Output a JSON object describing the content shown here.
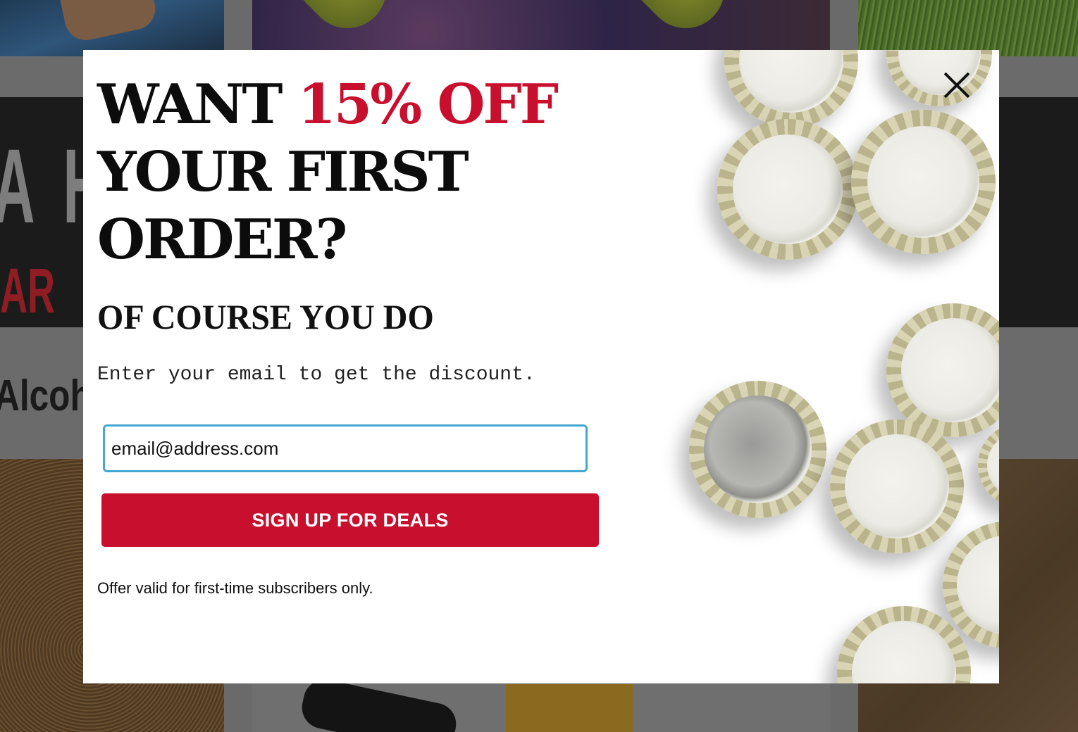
{
  "background": {
    "partial_heading": "Alcoh"
  },
  "popup": {
    "headline_part1": "WANT ",
    "headline_accent": "15% OFF",
    "headline_line2": "YOUR FIRST",
    "headline_line3": "ORDER?",
    "subheading": "OF COURSE YOU DO",
    "instruction": "Enter your email to get the discount.",
    "email_value": "email@address.com",
    "signup_button_label": "SIGN UP FOR DEALS",
    "fine_print": "Offer valid for first-time subscribers only.",
    "close_icon": "close-icon",
    "hero_image": "bottle-caps-image",
    "colors": {
      "accent": "#c8102e",
      "input_border": "#43a7d2",
      "background_overlay": "#6a6a6a"
    }
  }
}
